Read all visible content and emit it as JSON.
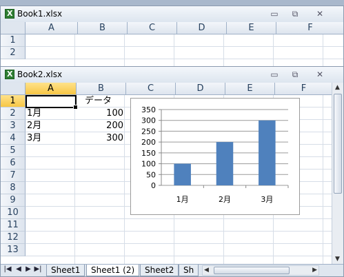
{
  "book1": {
    "title": "Book1.xlsx",
    "columns": [
      "A",
      "B",
      "C",
      "D",
      "E",
      "F"
    ],
    "rows": [
      "1",
      "2"
    ]
  },
  "book2": {
    "title": "Book2.xlsx",
    "columns": [
      "A",
      "B",
      "C",
      "D",
      "E",
      "F"
    ],
    "rows": [
      "1",
      "2",
      "3",
      "4",
      "5",
      "6",
      "7",
      "8",
      "9",
      "10",
      "11",
      "12",
      "13"
    ],
    "cells": {
      "B1": "データ",
      "A2": "1月",
      "B2": "100",
      "A3": "2月",
      "B3": "200",
      "A4": "3月",
      "B4": "300"
    },
    "tabs": [
      "Sheet1",
      "Sheet1 (2)",
      "Sheet2",
      "Sh"
    ],
    "active_tab": "Sheet1 (2)"
  },
  "window_buttons": {
    "minimize": "▭",
    "restore": "⧉",
    "close": "✕"
  },
  "chart_data": {
    "type": "bar",
    "categories": [
      "1月",
      "2月",
      "3月"
    ],
    "values": [
      100,
      200,
      300
    ],
    "ylim": [
      0,
      350
    ],
    "yticks": [
      0,
      50,
      100,
      150,
      200,
      250,
      300,
      350
    ],
    "grid": true,
    "bar_color": "#4f81bd"
  }
}
